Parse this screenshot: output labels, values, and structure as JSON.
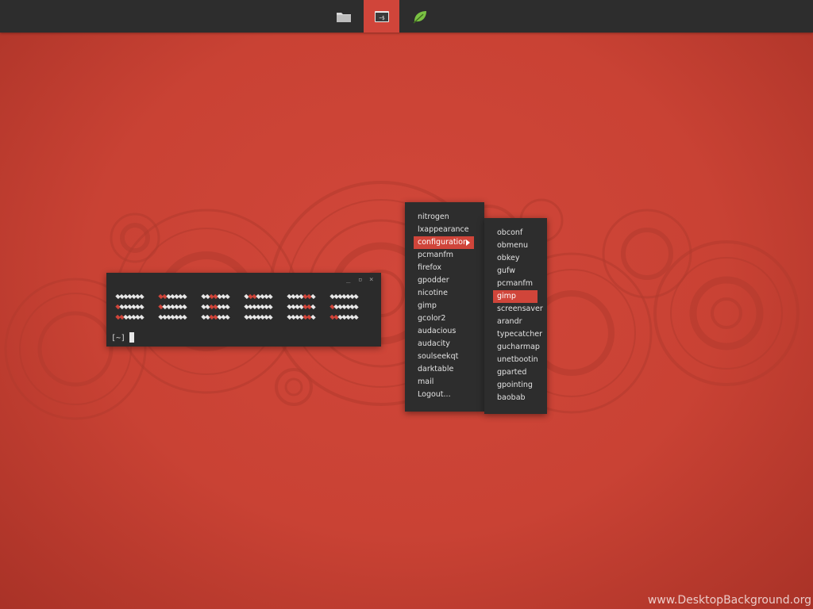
{
  "panel": {
    "buttons": [
      {
        "name": "file-manager",
        "icon": "folder-icon",
        "active": false
      },
      {
        "name": "terminal",
        "icon": "terminal-icon",
        "label": "~$",
        "active": true
      },
      {
        "name": "leaf-app",
        "icon": "leaf-icon",
        "active": false
      }
    ]
  },
  "terminal": {
    "controls": [
      "_",
      "▫",
      "×"
    ],
    "prompt": "[~]"
  },
  "menu": {
    "items": [
      {
        "label": "nitrogen"
      },
      {
        "label": "lxappearance"
      },
      {
        "label": "configuration",
        "highlighted": true,
        "submenu": true
      },
      {
        "label": "pcmanfm"
      },
      {
        "label": "firefox"
      },
      {
        "label": "gpodder"
      },
      {
        "label": "nicotine"
      },
      {
        "label": "gimp"
      },
      {
        "label": "gcolor2"
      },
      {
        "label": "audacious"
      },
      {
        "label": "audacity"
      },
      {
        "label": "soulseekqt"
      },
      {
        "label": "darktable"
      },
      {
        "label": "mail"
      },
      {
        "label": "Logout..."
      }
    ]
  },
  "submenu": {
    "items": [
      {
        "label": "obconf"
      },
      {
        "label": "obmenu"
      },
      {
        "label": "obkey"
      },
      {
        "label": "gufw"
      },
      {
        "label": "pcmanfm"
      },
      {
        "label": "gimp",
        "highlighted": true
      },
      {
        "label": "screensaver"
      },
      {
        "label": "arandr"
      },
      {
        "label": "typecatcher"
      },
      {
        "label": "gucharmap"
      },
      {
        "label": "unetbootin"
      },
      {
        "label": "gparted"
      },
      {
        "label": "gpointing"
      },
      {
        "label": "baobab"
      }
    ]
  },
  "watermark": "www.DesktopBackground.org",
  "colors": {
    "accent": "#d0453a",
    "panel": "#2d2d2d",
    "desktop": "#c94234"
  }
}
